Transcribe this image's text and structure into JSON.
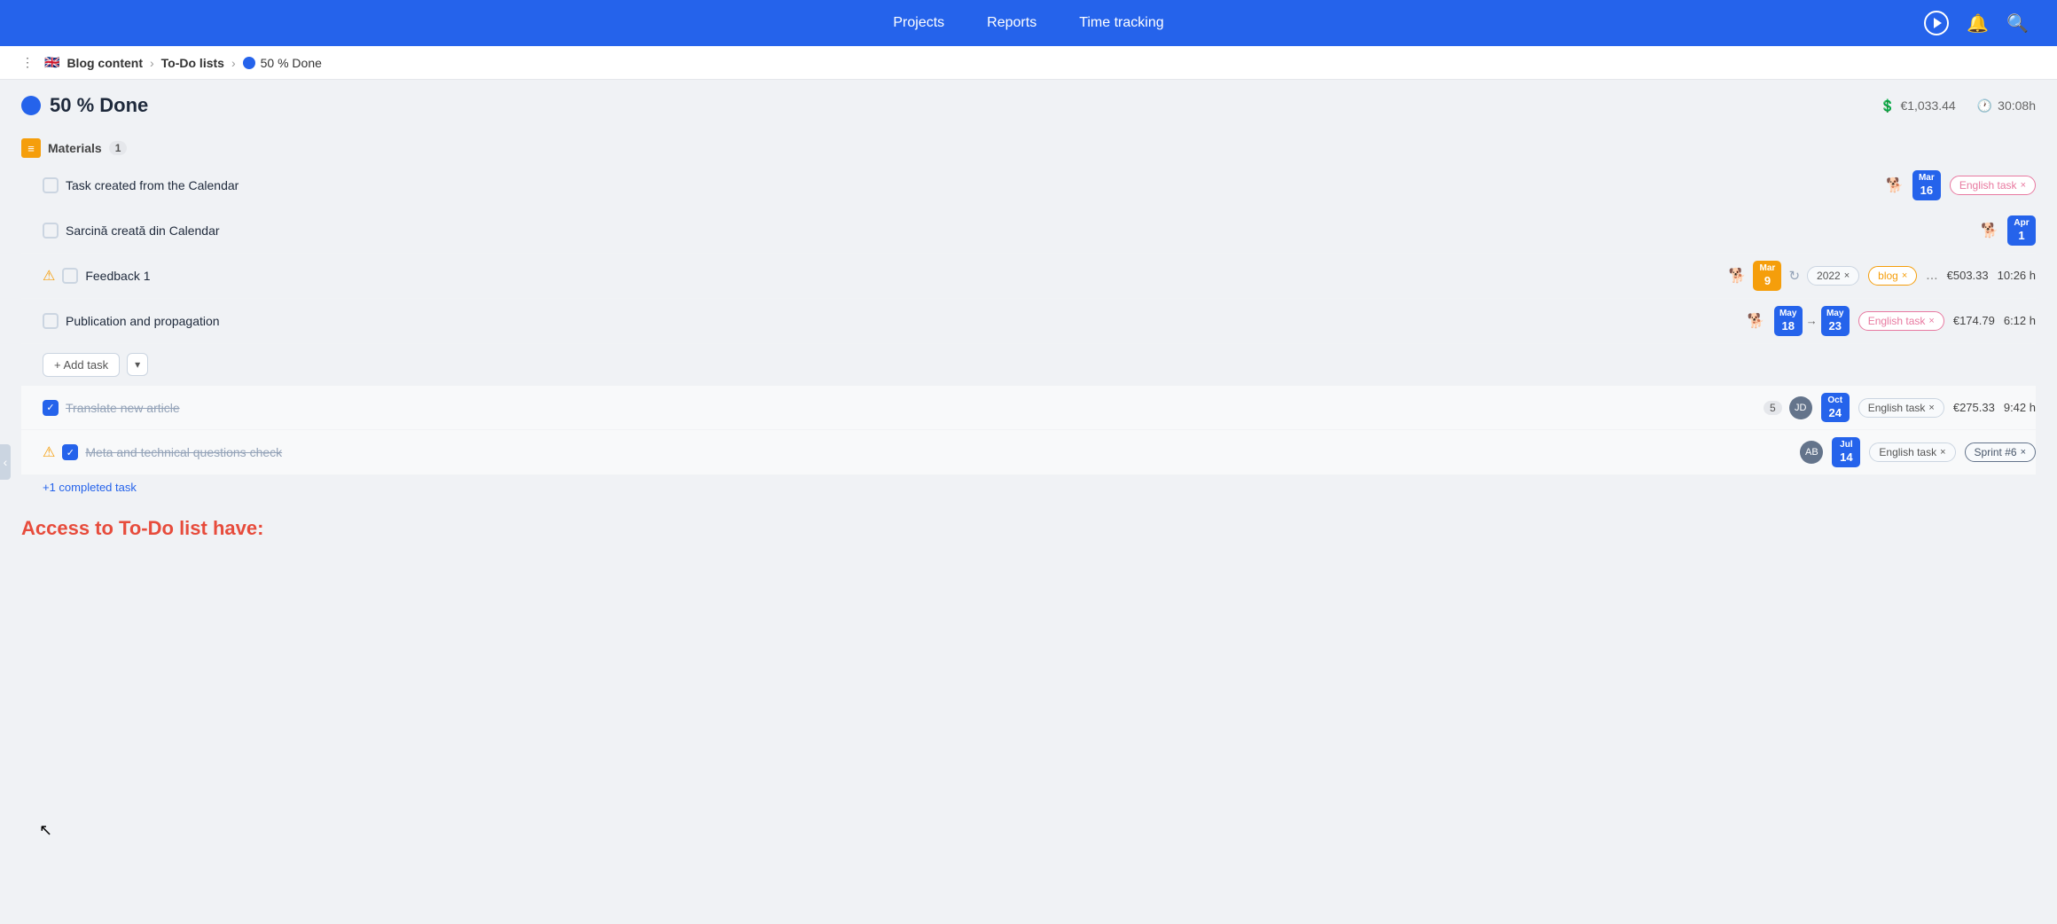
{
  "nav": {
    "projects_label": "Projects",
    "reports_label": "Reports",
    "time_tracking_label": "Time tracking"
  },
  "breadcrumb": {
    "flag": "🇬🇧",
    "root": "Blog content",
    "middle": "To-Do lists",
    "current": "50 % Done"
  },
  "section": {
    "title": "50 % Done",
    "budget_icon": "€",
    "budget": "€1,033.44",
    "time": "30:08h"
  },
  "groups": [
    {
      "name": "Materials",
      "count": "1",
      "tasks": [
        {
          "id": "task-1",
          "name": "Task created from the Calendar",
          "checked": false,
          "dog": "🐕",
          "date_month": "Mar",
          "date_day": "16",
          "date_color": "blue",
          "tags": [
            {
              "label": "English task",
              "type": "english"
            }
          ],
          "amount": "",
          "time": "",
          "warn": false
        },
        {
          "id": "task-2",
          "name": "Sarcină creată din Calendar",
          "checked": false,
          "dog": "🐕",
          "date_month": "Apr",
          "date_day": "1",
          "date_color": "blue",
          "tags": [],
          "amount": "",
          "time": "",
          "warn": false
        },
        {
          "id": "task-3",
          "name": "Feedback 1",
          "checked": false,
          "dog": "🐕",
          "date_month": "Mar",
          "date_day": "9",
          "date_color": "orange",
          "repeat": true,
          "tags": [
            {
              "label": "2022",
              "type": "gray"
            },
            {
              "label": "blog",
              "type": "blog"
            },
            {
              "label": "...",
              "type": "dots"
            }
          ],
          "amount": "€503.33",
          "time": "10:26 h",
          "warn": true
        },
        {
          "id": "task-4",
          "name": "Publication and propagation",
          "checked": false,
          "dog": "🐕",
          "date_start_month": "May",
          "date_start_day": "18",
          "date_end_month": "May",
          "date_end_day": "23",
          "date_color": "blue",
          "range": true,
          "tags": [
            {
              "label": "English task",
              "type": "english"
            }
          ],
          "amount": "€174.79",
          "time": "6:12 h",
          "warn": false
        }
      ]
    }
  ],
  "add_task": {
    "label": "+ Add task",
    "dropdown_icon": "▾"
  },
  "completed": [
    {
      "id": "task-done-1",
      "name": "Translate new article",
      "checked": true,
      "subtask_count": "5",
      "avatar_initials": "JD",
      "date_month": "Oct",
      "date_day": "24",
      "date_color": "blue",
      "tags": [
        {
          "label": "English task",
          "type": "gray"
        }
      ],
      "amount": "€275.33",
      "time": "9:42 h",
      "warn": false
    },
    {
      "id": "task-done-2",
      "name": "Meta and technical questions check",
      "checked": true,
      "avatar_initials": "AB",
      "date_month": "Jul",
      "date_day": "14",
      "date_color": "blue",
      "tags": [
        {
          "label": "English task",
          "type": "gray"
        },
        {
          "label": "Sprint #6",
          "type": "sprint"
        }
      ],
      "amount": "",
      "time": "",
      "warn": true
    }
  ],
  "completed_link": "+1 completed task",
  "access_section_title": "Access to To-Do list have:"
}
